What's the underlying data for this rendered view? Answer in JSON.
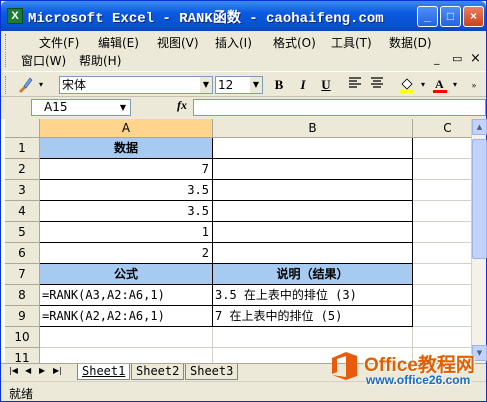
{
  "window": {
    "title": "Microsoft Excel - RANK函数 - caohaifeng.com",
    "controls": {
      "minimize": "_",
      "maximize": "□",
      "close": "×"
    }
  },
  "menu": {
    "row1": [
      "文件(F)",
      "编辑(E)",
      "视图(V)",
      "插入(I)",
      "格式(O)",
      "工具(T)",
      "数据(D)"
    ],
    "row2": [
      "窗口(W)",
      "帮助(H)"
    ],
    "mdi": {
      "minimize": "_",
      "restore": "▭",
      "close": "×"
    }
  },
  "toolbar": {
    "font_name": "宋体",
    "font_size": "12",
    "bold": "B",
    "italic": "I",
    "underline": "U",
    "fill_color": "#ffff00",
    "font_color": "#ff0000"
  },
  "formula_bar": {
    "name_box": "A15",
    "fx": "fx",
    "formula": ""
  },
  "grid": {
    "columns": [
      "A",
      "B",
      "C"
    ],
    "rows": [
      "1",
      "2",
      "3",
      "4",
      "5",
      "6",
      "7",
      "8",
      "9",
      "10",
      "11"
    ],
    "cells": {
      "a1": "数据",
      "b1": "",
      "a2": "7",
      "a3": "3.5",
      "a4": "3.5",
      "a5": "1",
      "a6": "2",
      "a7": "公式",
      "b7": "说明（结果）",
      "a8": "=RANK(A3,A2:A6,1)",
      "b8": "3.5 在上表中的排位 (3)",
      "a9": "=RANK(A2,A2:A6,1)",
      "b9": "7 在上表中的排位 (5)"
    }
  },
  "sheets": {
    "tabs": [
      "Sheet1",
      "Sheet2",
      "Sheet3"
    ],
    "active": "Sheet1"
  },
  "status": {
    "text": "就绪"
  },
  "watermark": {
    "title": "Office教程网",
    "url": "www.office26.com"
  }
}
